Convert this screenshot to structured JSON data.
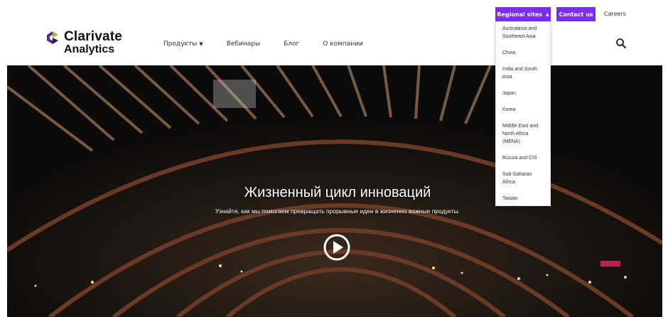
{
  "utility_bar": {
    "regional_label": "Regional sites",
    "contact_label": "Contact us",
    "careers_label": "Careers"
  },
  "logo": {
    "line1": "Clarivate",
    "line2": "Analytics"
  },
  "nav": {
    "items": [
      {
        "label": "Продукты"
      },
      {
        "label": "Вебинары"
      },
      {
        "label": "Блог"
      },
      {
        "label": "О компании"
      }
    ]
  },
  "regional_dropdown": {
    "items": [
      "Australasia and Southeast Asia",
      "China",
      "India and South Asia",
      "Japan",
      "Korea",
      "Middle East and North Africa (MENA)",
      "Russia and CIS",
      "Sub-Saharan Africa",
      "Taiwan"
    ]
  },
  "hero": {
    "title": "Жизненный цикл инноваций",
    "subtitle": "Узнайте, как мы помогаем превращать прорывные идеи в жизненно важные продукты."
  },
  "colors": {
    "accent": "#7c2cf0",
    "logo_green": "#8bc63f",
    "logo_purple": "#5a2a8c"
  },
  "icons": {
    "search": "search-icon",
    "play": "play-icon",
    "caret": "chevron-down-icon"
  }
}
